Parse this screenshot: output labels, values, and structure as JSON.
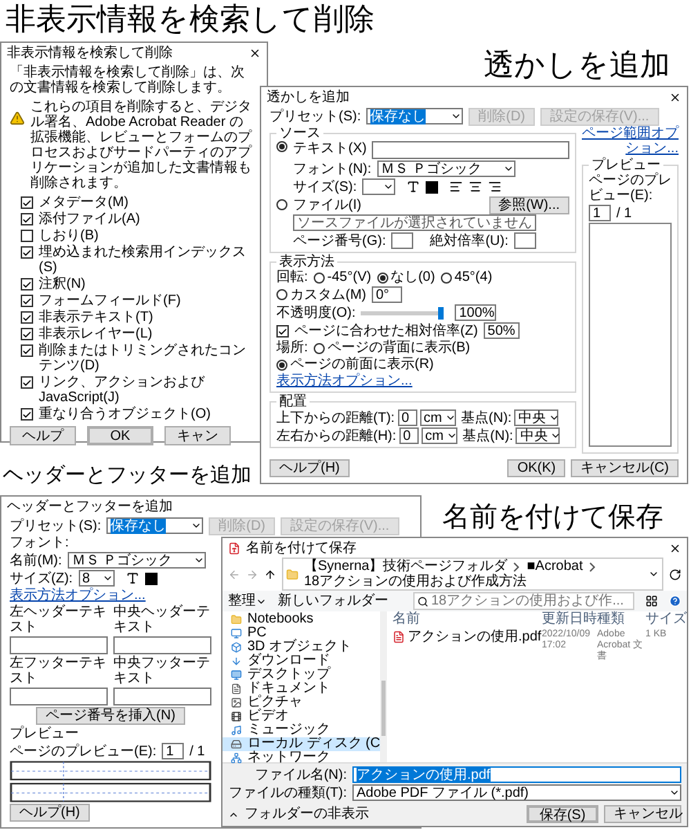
{
  "hidden_info": {
    "heading": "非表示情報を検索して削除",
    "title": "非表示情報を検索して削除",
    "intro": "「非表示情報を検索して削除」は、次の文書情報を検索して削除します。",
    "warning": "これらの項目を削除すると、デジタル署名、Adobe Acrobat Reader の拡張機能、レビューとフォームのプロセスおよびサードパーティのアプリケーションが追加した文書情報も削除されます。",
    "items": [
      {
        "label": "メタデータ(M)",
        "checked": true
      },
      {
        "label": "添付ファイル(A)",
        "checked": true
      },
      {
        "label": "しおり(B)",
        "checked": false
      },
      {
        "label": "埋め込まれた検索用インデックス(S)",
        "checked": true
      },
      {
        "label": "注釈(N)",
        "checked": true
      },
      {
        "label": "フォームフィールド(F)",
        "checked": true
      },
      {
        "label": "非表示テキスト(T)",
        "checked": true
      },
      {
        "label": "非表示レイヤー(L)",
        "checked": true
      },
      {
        "label": "削除またはトリミングされたコンテンツ(D)",
        "checked": true
      },
      {
        "label": "リンク、アクションおよび JavaScript(J)",
        "checked": true
      },
      {
        "label": "重なり合うオブジェクト(O)",
        "checked": true
      }
    ],
    "buttons": [
      {
        "label": "ヘルプ",
        "default": false
      },
      {
        "label": "OK",
        "default": true
      },
      {
        "label": "キャン",
        "default": false
      }
    ]
  },
  "watermark": {
    "heading": "透かしを追加",
    "title": "透かしを追加",
    "preset": {
      "label": "プリセット(S):",
      "value": "保存なし",
      "highlighted": true,
      "buttons": [
        {
          "label": "削除(D)",
          "disabled": true
        },
        {
          "label": "設定の保存(V)...",
          "disabled": true
        }
      ]
    },
    "page_range_link": "ページ範囲オプション...",
    "source": {
      "legend": "ソース",
      "options": [
        {
          "label": "テキスト(X)",
          "selected": true
        },
        {
          "label": "ファイル(I)",
          "selected": false
        }
      ],
      "font_label": "フォント(N):",
      "font": "ＭＳ Ｐゴシック",
      "size_label": "サイズ(S):",
      "file_path": "ソースファイルが選択されていません",
      "browse": "参照(W)...",
      "page_number_label": "ページ番号(G):",
      "scale_label": "絶対倍率(U):"
    },
    "appearance": {
      "legend": "表示方法",
      "rotation_label": "回転:",
      "rotations": [
        {
          "label": "-45°(V)",
          "selected": false
        },
        {
          "label": "なし(0)",
          "selected": true
        },
        {
          "label": "45°(4)",
          "selected": false
        },
        {
          "label": "カスタム(M)",
          "selected": false
        }
      ],
      "custom_angle": "0°",
      "opacity_label": "不透明度(O):",
      "opacity": {
        "level": 1.0
      },
      "opacity_value": "100%",
      "relative_scale": {
        "label": "ページに合わせた相対倍率(Z)",
        "checked": true,
        "value": "50%"
      },
      "location_label": "場所:",
      "locations": [
        {
          "label": "ページの背面に表示(B)",
          "selected": false
        },
        {
          "label": "ページの前面に表示(R)",
          "selected": true
        }
      ],
      "options_link": "表示方法オプション..."
    },
    "position": {
      "legend": "配置",
      "rows": [
        {
          "label": "上下からの距離(T):",
          "value": "0",
          "unit": "cm",
          "anchor_label": "基点(N):",
          "anchor": "中央"
        },
        {
          "label": "左右からの距離(H):",
          "value": "0",
          "unit": "cm",
          "anchor_label": "基点(N):",
          "anchor": "中央"
        }
      ]
    },
    "preview": {
      "legend": "プレビュー",
      "page_label": "ページのプレビュー(E):",
      "page": "1",
      "total": "/ 1"
    },
    "buttons": {
      "help": "ヘルプ(H)",
      "ok": "OK(K)",
      "cancel": "キャンセル(C)"
    }
  },
  "header_footer": {
    "heading": "ヘッダーとフッターを追加",
    "title": "ヘッダーとフッターを追加",
    "preset": {
      "label": "プリセット(S):",
      "value": "保存なし",
      "highlighted": true,
      "buttons": [
        {
          "label": "削除(D)",
          "disabled": true
        },
        {
          "label": "設定の保存(V)...",
          "disabled": true
        }
      ]
    },
    "font": {
      "legend": "フォント:",
      "name_label": "名前(M):",
      "name": "ＭＳ Ｐゴシック",
      "size_label": "サイズ(Z):",
      "size": "8"
    },
    "options_link": "表示方法オプション...",
    "header_labels": [
      "左ヘッダーテキスト",
      "中央ヘッダーテキスト"
    ],
    "footer_labels": [
      "左フッターテキスト",
      "中央フッターテキスト"
    ],
    "insert_page_number": "ページ番号を挿入(N)",
    "preview": {
      "legend": "プレビュー",
      "page_label": "ページのプレビュー(E):",
      "page": "1",
      "total": "/ 1"
    },
    "help": "ヘルプ(H)"
  },
  "save_as": {
    "heading": "名前を付けて保存",
    "title": "名前を付けて保存",
    "path": [
      "【Synerna】技術ページフォルダ",
      "■Acrobat",
      "18アクションの使用および作成方法"
    ],
    "search": {
      "placeholder": "18アクションの使用および作..."
    },
    "organize": "整理",
    "new_folder": "新しいフォルダー",
    "sidebar": [
      {
        "label": "Notebooks",
        "kind": "folder",
        "selected": false
      },
      {
        "label": "PC",
        "kind": "pc",
        "selected": false
      },
      {
        "label": "3D オブジェクト",
        "kind": "objects3d",
        "selected": false
      },
      {
        "label": "ダウンロード",
        "kind": "download",
        "selected": false
      },
      {
        "label": "デスクトップ",
        "kind": "desktop",
        "selected": false
      },
      {
        "label": "ドキュメント",
        "kind": "document",
        "selected": false
      },
      {
        "label": "ピクチャ",
        "kind": "pictures",
        "selected": false
      },
      {
        "label": "ビデオ",
        "kind": "video",
        "selected": false
      },
      {
        "label": "ミュージック",
        "kind": "music",
        "selected": false
      },
      {
        "label": "ローカル ディスク (C",
        "kind": "disk",
        "selected": true
      },
      {
        "label": "ネットワーク",
        "kind": "network",
        "selected": false
      }
    ],
    "columns": [
      "名前",
      "更新日時",
      "種類",
      "サイズ"
    ],
    "files": [
      {
        "name": "アクションの使用.pdf",
        "modified": "2022/10/09 17:02",
        "type": "Adobe Acrobat 文書",
        "size": "1 KB"
      }
    ],
    "file_name": {
      "label": "ファイル名(N):",
      "value": "アクションの使用.pdf",
      "text_selected": true
    },
    "file_type": {
      "label": "ファイルの種類(T):",
      "value": "Adobe PDF ファイル (*.pdf)"
    },
    "hide_folders": "フォルダーの非表示",
    "buttons": {
      "save": "保存(S)",
      "cancel": "キャンセル"
    }
  }
}
